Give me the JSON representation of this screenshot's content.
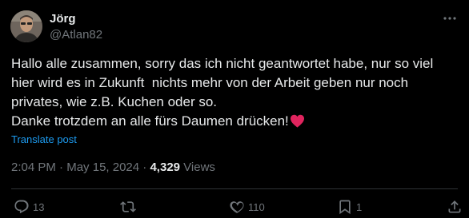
{
  "author": {
    "display_name": "Jörg",
    "handle": "@Atlan82",
    "avatar_icon": "profile-photo"
  },
  "tweet": {
    "lines": [
      "Hallo alle zusammen, sorry das ich nicht geantwortet habe, nur so viel",
      "hier wird es in Zukunft  nichts mehr von der Arbeit geben nur noch",
      "privates, wie z.B. Kuchen oder so.",
      "Danke trotzdem an alle fürs Daumen drücken!"
    ],
    "emoji": "red-heart",
    "translate_label": "Translate post"
  },
  "meta": {
    "time": "2:04 PM",
    "separator": " · ",
    "date": "May 15, 2024",
    "separator2": " · ",
    "views_count": "4,329",
    "views_label": " Views"
  },
  "actions": {
    "reply_count": "13",
    "retweet_count": "",
    "like_count": "110",
    "bookmark_count": "1"
  },
  "colors": {
    "background": "#000000",
    "text": "#e7e9ea",
    "muted": "#71767b",
    "link": "#1d9bf0",
    "divider": "#2f3336",
    "heart": "#e0245e"
  }
}
